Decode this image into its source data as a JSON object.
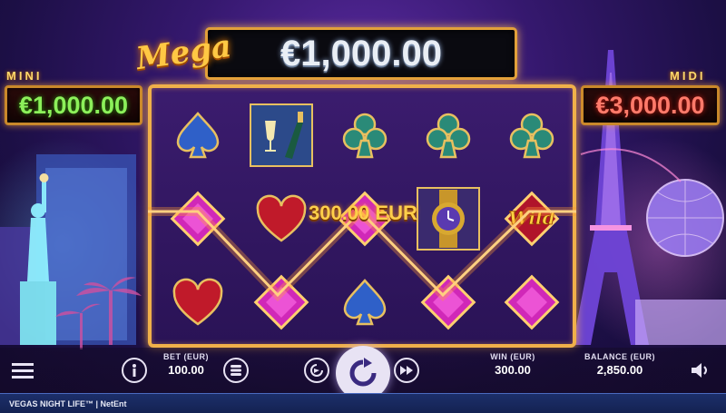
{
  "jackpots": {
    "mini": {
      "label": "MINI",
      "value": "€1,000.00"
    },
    "midi": {
      "label": "MIDI",
      "value": "€3,000.00"
    },
    "mega": {
      "label": "Mega",
      "value": "€1,000.00"
    }
  },
  "reels": [
    [
      "spade",
      "champagne",
      "club",
      "club",
      "club"
    ],
    [
      "diamond",
      "heart",
      "diamond",
      "watch",
      "wild"
    ],
    [
      "heart",
      "diamond",
      "spade",
      "diamond",
      "diamond"
    ]
  ],
  "wild_label": "Wild",
  "win_display": "300.00 EUR",
  "controls": {
    "bet_label": "BET (EUR)",
    "bet_value": "100.00",
    "win_label": "WIN (EUR)",
    "win_value": "300.00",
    "balance_label": "BALANCE (EUR)",
    "balance_value": "2,850.00",
    "icons": [
      "menu-icon",
      "info-icon",
      "coin-stack-icon",
      "autoplay-icon",
      "spin-icon",
      "fast-forward-icon",
      "sound-icon"
    ]
  },
  "footer_text": "VEGAS NIGHT LIFE™ | NetEnt",
  "colors": {
    "gold": "#f0b04a",
    "win_line": "#ff7a20",
    "diamond": "#e030c8",
    "mini_value": "#8cf05a",
    "midi_value": "#ff7a6a"
  }
}
